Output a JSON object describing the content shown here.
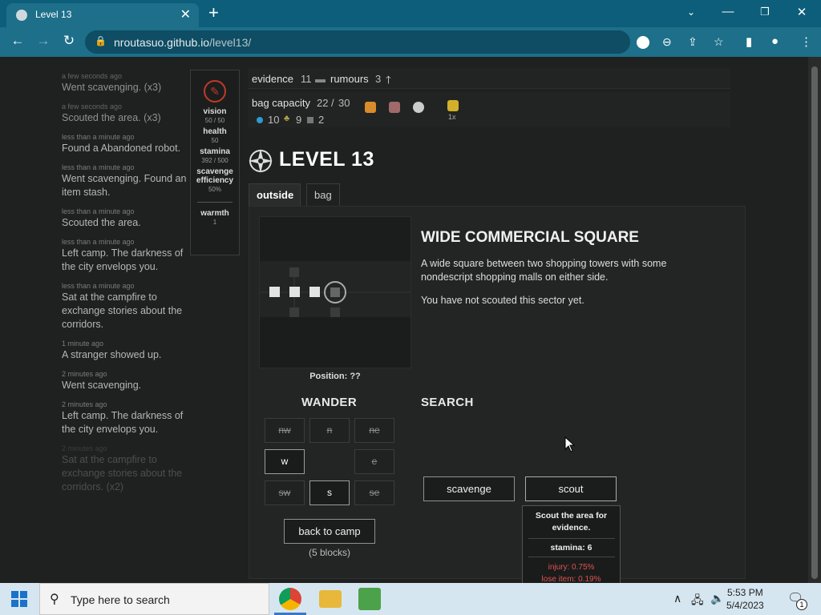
{
  "browser": {
    "tab_title": "Level 13",
    "url_host": "nroutasuo.github.io",
    "url_path": "/level13/"
  },
  "log": [
    {
      "time": "a few seconds ago",
      "text": "Went scavenging. (x3)",
      "fade": "fade1"
    },
    {
      "time": "a few seconds ago",
      "text": "Scouted the area. (x3)",
      "fade": "fade1"
    },
    {
      "time": "less than a minute ago",
      "text": "Found a Abandoned robot.",
      "fade": ""
    },
    {
      "time": "less than a minute ago",
      "text": "Went scavenging. Found an item stash.",
      "fade": ""
    },
    {
      "time": "less than a minute ago",
      "text": "Scouted the area.",
      "fade": ""
    },
    {
      "time": "less than a minute ago",
      "text": "Left camp. The darkness of the city envelops you.",
      "fade": ""
    },
    {
      "time": "less than a minute ago",
      "text": "Sat at the campfire to exchange stories about the corridors.",
      "fade": ""
    },
    {
      "time": "1 minute ago",
      "text": "A stranger showed up.",
      "fade": ""
    },
    {
      "time": "2 minutes ago",
      "text": "Went scavenging.",
      "fade": ""
    },
    {
      "time": "2 minutes ago",
      "text": "Left camp. The darkness of the city envelops you.",
      "fade": ""
    },
    {
      "time": "2 minutes ago",
      "text": "Sat at the campfire to exchange stories about the corridors. (x2)",
      "fade": "fade3"
    }
  ],
  "stats": {
    "vision_label": "vision",
    "vision_val": "50 / 50",
    "health_label": "health",
    "health_val": "50",
    "stamina_label": "stamina",
    "stamina_val": "392 / 500",
    "scav_label": "scavenge efficiency",
    "scav_val": "50%",
    "warmth_label": "warmth",
    "warmth_val": "1"
  },
  "header": {
    "evidence_label": "evidence",
    "evidence_val": "11",
    "rumours_label": "rumours",
    "rumours_val": "3",
    "bag_label": "bag capacity",
    "bag_val": "22",
    "bag_max": "30",
    "water": "10",
    "food": "9",
    "metal": "2",
    "lock_mult": "1x"
  },
  "level": {
    "title": "LEVEL 13"
  },
  "tabs": {
    "outside": "outside",
    "bag": "bag"
  },
  "sector": {
    "title": "WIDE COMMERCIAL SQUARE",
    "desc": "A wide square between two shopping towers with some nondescript shopping malls on either side.",
    "note": "You have not scouted this sector yet.",
    "position": "Position: ??"
  },
  "wander": {
    "heading": "WANDER",
    "nw": "nw",
    "n": "n",
    "ne": "ne",
    "w": "w",
    "e": "e",
    "sw": "sw",
    "s": "s",
    "se": "se",
    "camp": "back to camp",
    "camp_dist": "(5 blocks)"
  },
  "search": {
    "heading": "SEARCH",
    "scavenge": "scavenge",
    "scout": "scout"
  },
  "tooltip": {
    "desc": "Scout the area for evidence.",
    "stamina": "stamina: 6",
    "injury": "injury: 0.75%",
    "lose": "lose item: 0.19%"
  },
  "taskbar": {
    "search_placeholder": "Type here to search",
    "time": "5:53 PM",
    "date": "5/4/2023",
    "notif_count": "1"
  }
}
